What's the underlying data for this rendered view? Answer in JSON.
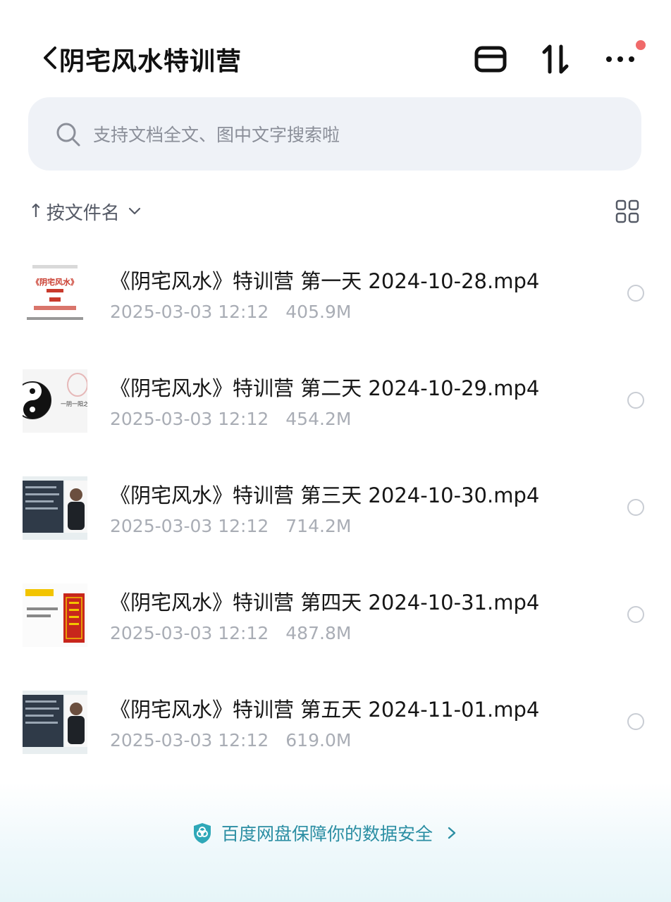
{
  "header": {
    "title": "阴宅风水特训营",
    "icons": [
      "back-chevron-icon",
      "tray-icon",
      "sort-arrows-icon",
      "more-icon"
    ],
    "notification_dot_color": "#f06a6a"
  },
  "search": {
    "placeholder": "支持文档全文、图中文字搜索啦"
  },
  "sort": {
    "arrow": "↑",
    "label": "按文件名"
  },
  "files": [
    {
      "name": "《阴宅风水》特训营 第一天 2024-10-28.mp4",
      "date": "2025-03-03 12:12",
      "size": "405.9M",
      "thumb_text": "《阴宅风水》"
    },
    {
      "name": "《阴宅风水》特训营 第二天 2024-10-29.mp4",
      "date": "2025-03-03 12:12",
      "size": "454.2M",
      "thumb_text": "一阴一阳之谓"
    },
    {
      "name": "《阴宅风水》特训营 第三天 2024-10-30.mp4",
      "date": "2025-03-03 12:12",
      "size": "714.2M"
    },
    {
      "name": "《阴宅风水》特训营 第四天 2024-10-31.mp4",
      "date": "2025-03-03 12:12",
      "size": "487.8M"
    },
    {
      "name": "《阴宅风水》特训营 第五天 2024-11-01.mp4",
      "date": "2025-03-03 12:12",
      "size": "619.0M"
    }
  ],
  "footer": {
    "text": "百度网盘保障你的数据安全"
  },
  "colors": {
    "search_bg": "#eff2f7",
    "footer_text": "#2b8ea3",
    "meta_text": "#a9adb5"
  }
}
